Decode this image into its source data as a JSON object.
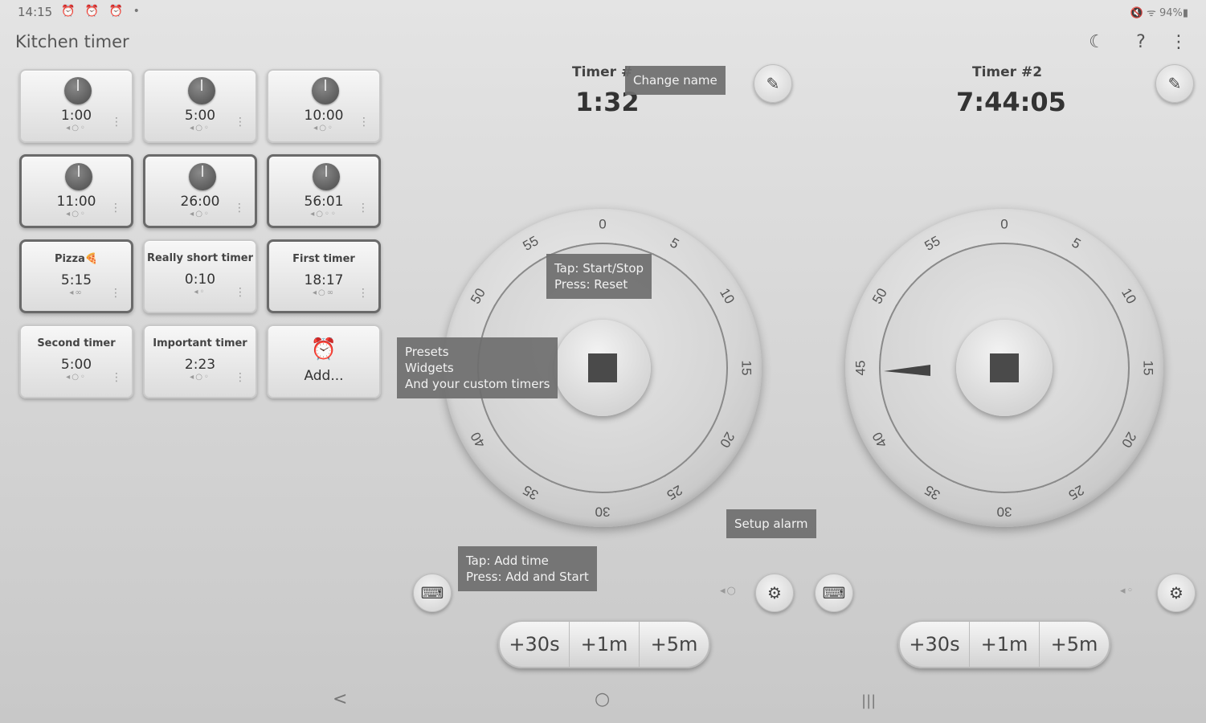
{
  "status": {
    "time": "14:15",
    "icons": "⏰ ⏰ ⏰ •",
    "right": "🔇 ᯤ 94%▮"
  },
  "app": {
    "title": "Kitchen timer"
  },
  "topbar": {
    "night_icon": "moon-icon",
    "help_icon": "help-icon",
    "menu_icon": "more-icon"
  },
  "presets": [
    {
      "time": "1:00",
      "icons": "◂○◦"
    },
    {
      "time": "5:00",
      "icons": "◂○◦"
    },
    {
      "time": "10:00",
      "icons": "◂○◦"
    },
    {
      "time": "11:00",
      "icons": "◂○◦"
    },
    {
      "time": "26:00",
      "icons": "◂○◦"
    },
    {
      "time": "56:01",
      "icons": "◂○◦◦"
    },
    {
      "name": "Pizza🍕",
      "time": "5:15",
      "icons": "◂∞"
    },
    {
      "name": "Really short timer",
      "time": "0:10",
      "icons": "◂◦"
    },
    {
      "name": "First timer",
      "time": "18:17",
      "icons": "◂○∞"
    },
    {
      "name": "Second timer",
      "time": "5:00",
      "icons": "◂○◦"
    },
    {
      "name": "Important timer",
      "time": "2:23",
      "icons": "◂○◦"
    },
    {
      "add_label": "Add..."
    }
  ],
  "timer1": {
    "name": "Timer #",
    "time": "1:32"
  },
  "timer2": {
    "name": "Timer #2",
    "time": "7:44:05"
  },
  "dial_labels": [
    "0",
    "5",
    "10",
    "15",
    "20",
    "25",
    "30",
    "35",
    "40",
    "45",
    "50",
    "55"
  ],
  "timer1_dial_labels": [
    "0",
    "5",
    "10",
    "15",
    "20",
    "25",
    "30",
    "35",
    "40",
    "",
    "50",
    "55"
  ],
  "add_buttons": [
    "+30s",
    "+1m",
    "+5m"
  ],
  "tooltips": {
    "change_name": "Change name",
    "tap_start_1": "Tap: Start/Stop",
    "tap_start_2": "Press: Reset",
    "presets_1": "Presets",
    "presets_2": "Widgets",
    "presets_3": "And your custom timers",
    "setup_alarm": "Setup alarm",
    "add_time_1": "Tap: Add time",
    "add_time_2": "Press: Add and Start"
  },
  "timer1_mini_icons": "◂○",
  "timer2_mini_icons": "◂◦",
  "nav": {
    "back": "<",
    "home": "○",
    "recents": "|||"
  }
}
